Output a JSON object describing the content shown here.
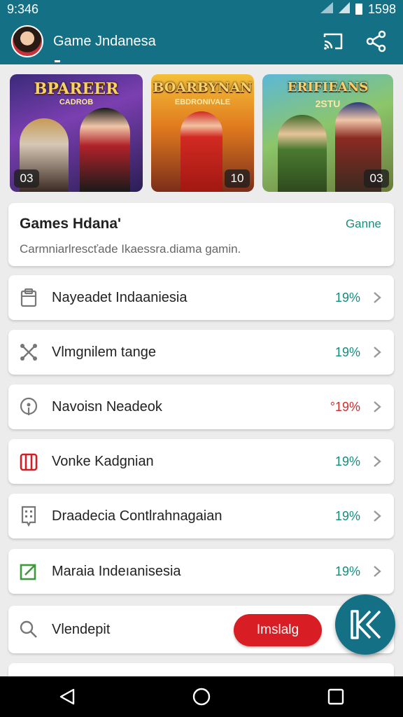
{
  "status_bar": {
    "time": "9:346",
    "battery": "1598"
  },
  "app_bar": {
    "title": "Game Jndanesa",
    "icons": [
      "avatar",
      "cast-icon",
      "share-icon"
    ]
  },
  "banners": [
    {
      "title": "BPAREER",
      "subtitle": "CADROB",
      "badge": "03"
    },
    {
      "title": "BOARBYNAN",
      "subtitle": "EBDRONIVALE",
      "badge": "10"
    },
    {
      "title": "ERIFIEANS",
      "subtitle": "2STU",
      "badge": "03"
    }
  ],
  "info_card": {
    "title": "Games Hdana'",
    "link": "Ganne",
    "description": "Carmniarlrescťade Ikaessra.diama gamin."
  },
  "list": [
    {
      "label": "Nayeadet Indaaniesia",
      "value": "19%",
      "icon": "clipboard-icon",
      "color": "#138c80"
    },
    {
      "label": "Vlmgnilem tange",
      "value": "19%",
      "icon": "cross-tools-icon",
      "color": "#138c80"
    },
    {
      "label": "Navoisn Neadeok",
      "value": "°19%",
      "icon": "location-pin-icon",
      "color": "#d42b2b"
    },
    {
      "label": "Vonke Kadgnian",
      "value": "19%",
      "icon": "luggage-icon",
      "color": "#138c80"
    },
    {
      "label": "Draadecia Contlrahnagaian",
      "value": "19%",
      "icon": "building-icon",
      "color": "#138c80"
    },
    {
      "label": "Maraia Indeıanisesia",
      "value": "19%",
      "icon": "edit-square-icon",
      "color": "#138c80"
    }
  ],
  "search_row": {
    "label": "Vlendepit",
    "button": "Imslalg"
  },
  "colors": {
    "primary": "#137085",
    "accent_red": "#d81e24",
    "teal_text": "#138c80"
  }
}
